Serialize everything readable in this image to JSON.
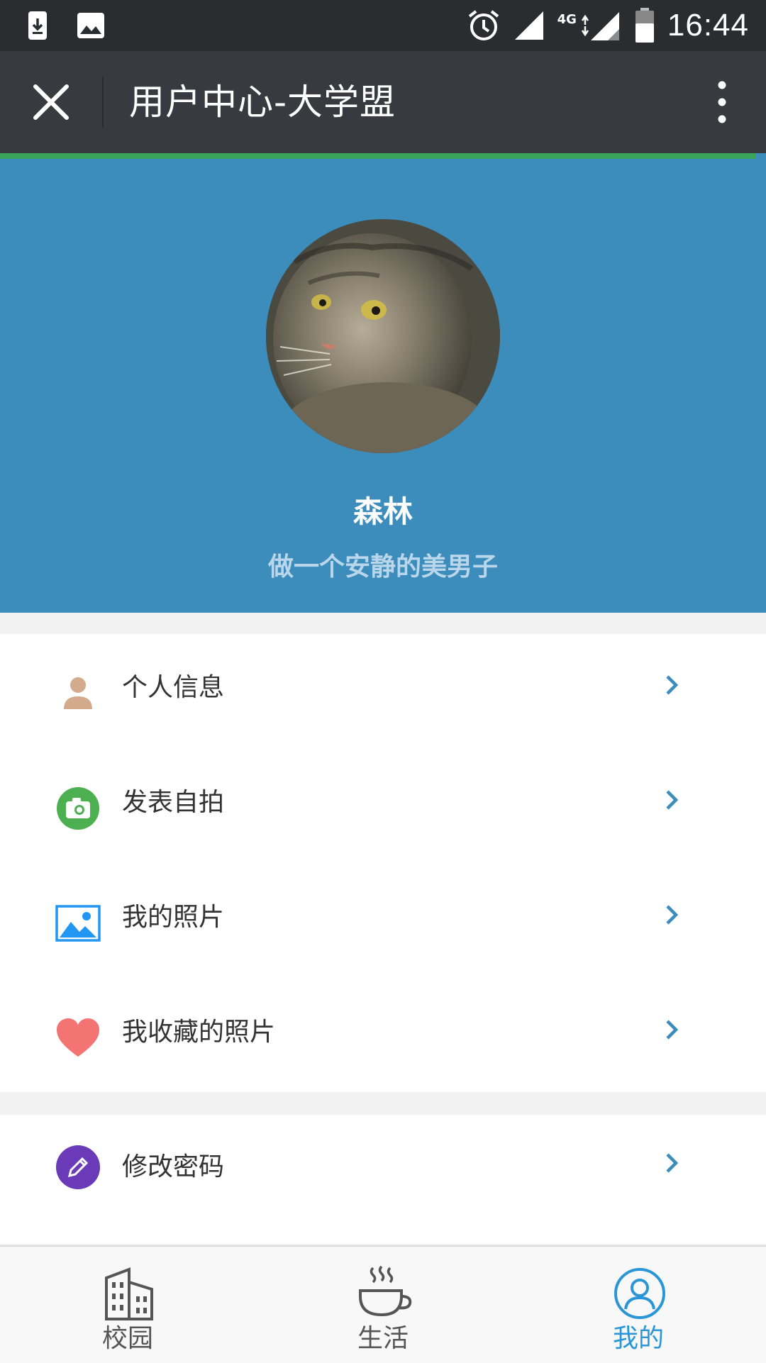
{
  "status_bar": {
    "time": "16:44",
    "network": "4G",
    "icons": [
      "download-icon",
      "image-icon",
      "alarm-icon",
      "signal-icon",
      "battery-icon"
    ]
  },
  "title_bar": {
    "title": "用户中心-大学盟",
    "close_icon": "close-icon",
    "more_icon": "more-vertical-icon"
  },
  "profile": {
    "username": "森林",
    "signature": "做一个安静的美男子",
    "header_color": "#3c8cbc"
  },
  "menu": {
    "group1": [
      {
        "label": "个人信息",
        "icon": "person-icon",
        "color": "#d3aa8c"
      },
      {
        "label": "发表自拍",
        "icon": "camera-icon",
        "color": "#4caf50"
      },
      {
        "label": "我的照片",
        "icon": "photo-icon",
        "color": "#2196f3"
      },
      {
        "label": "我收藏的照片",
        "icon": "heart-icon",
        "color": "#f47474"
      }
    ],
    "group2": [
      {
        "label": "修改密码",
        "icon": "pencil-icon",
        "color": "#6a3ab8"
      }
    ]
  },
  "tabs": [
    {
      "label": "校园",
      "icon": "building-icon",
      "active": false
    },
    {
      "label": "生活",
      "icon": "coffee-cup-icon",
      "active": false
    },
    {
      "label": "我的",
      "icon": "user-icon",
      "active": true
    }
  ],
  "colors": {
    "accent": "#2a96d8",
    "chevron": "#3c8cbc",
    "title_bar": "#393a3f"
  }
}
